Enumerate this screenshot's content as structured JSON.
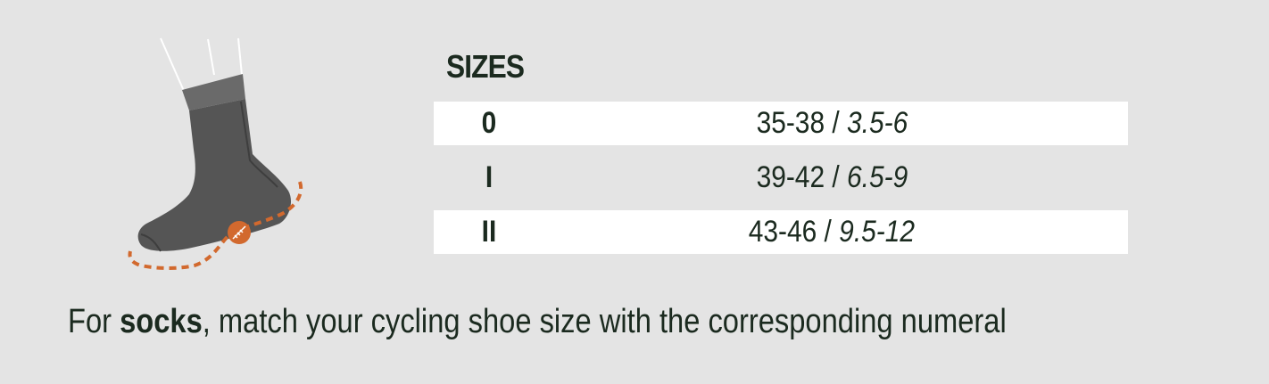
{
  "title": "SIZES",
  "sizes": [
    {
      "code": "0",
      "eu": "35-38",
      "separator": " / ",
      "us": "3.5-6",
      "shaded": true
    },
    {
      "code": "I",
      "eu": "39-42",
      "separator": " / ",
      "us": "6.5-9",
      "shaded": false
    },
    {
      "code": "II",
      "eu": "43-46",
      "separator": " / ",
      "us": "9.5-12",
      "shaded": true
    }
  ],
  "footnote": {
    "prefix": "For ",
    "emphasis": "socks",
    "suffix": ", match your cycling shoe size with the corresponding numeral"
  },
  "illustration": {
    "icon": "sock-measure-icon",
    "sock_color": "#555555",
    "measure_color": "#d2692e"
  }
}
